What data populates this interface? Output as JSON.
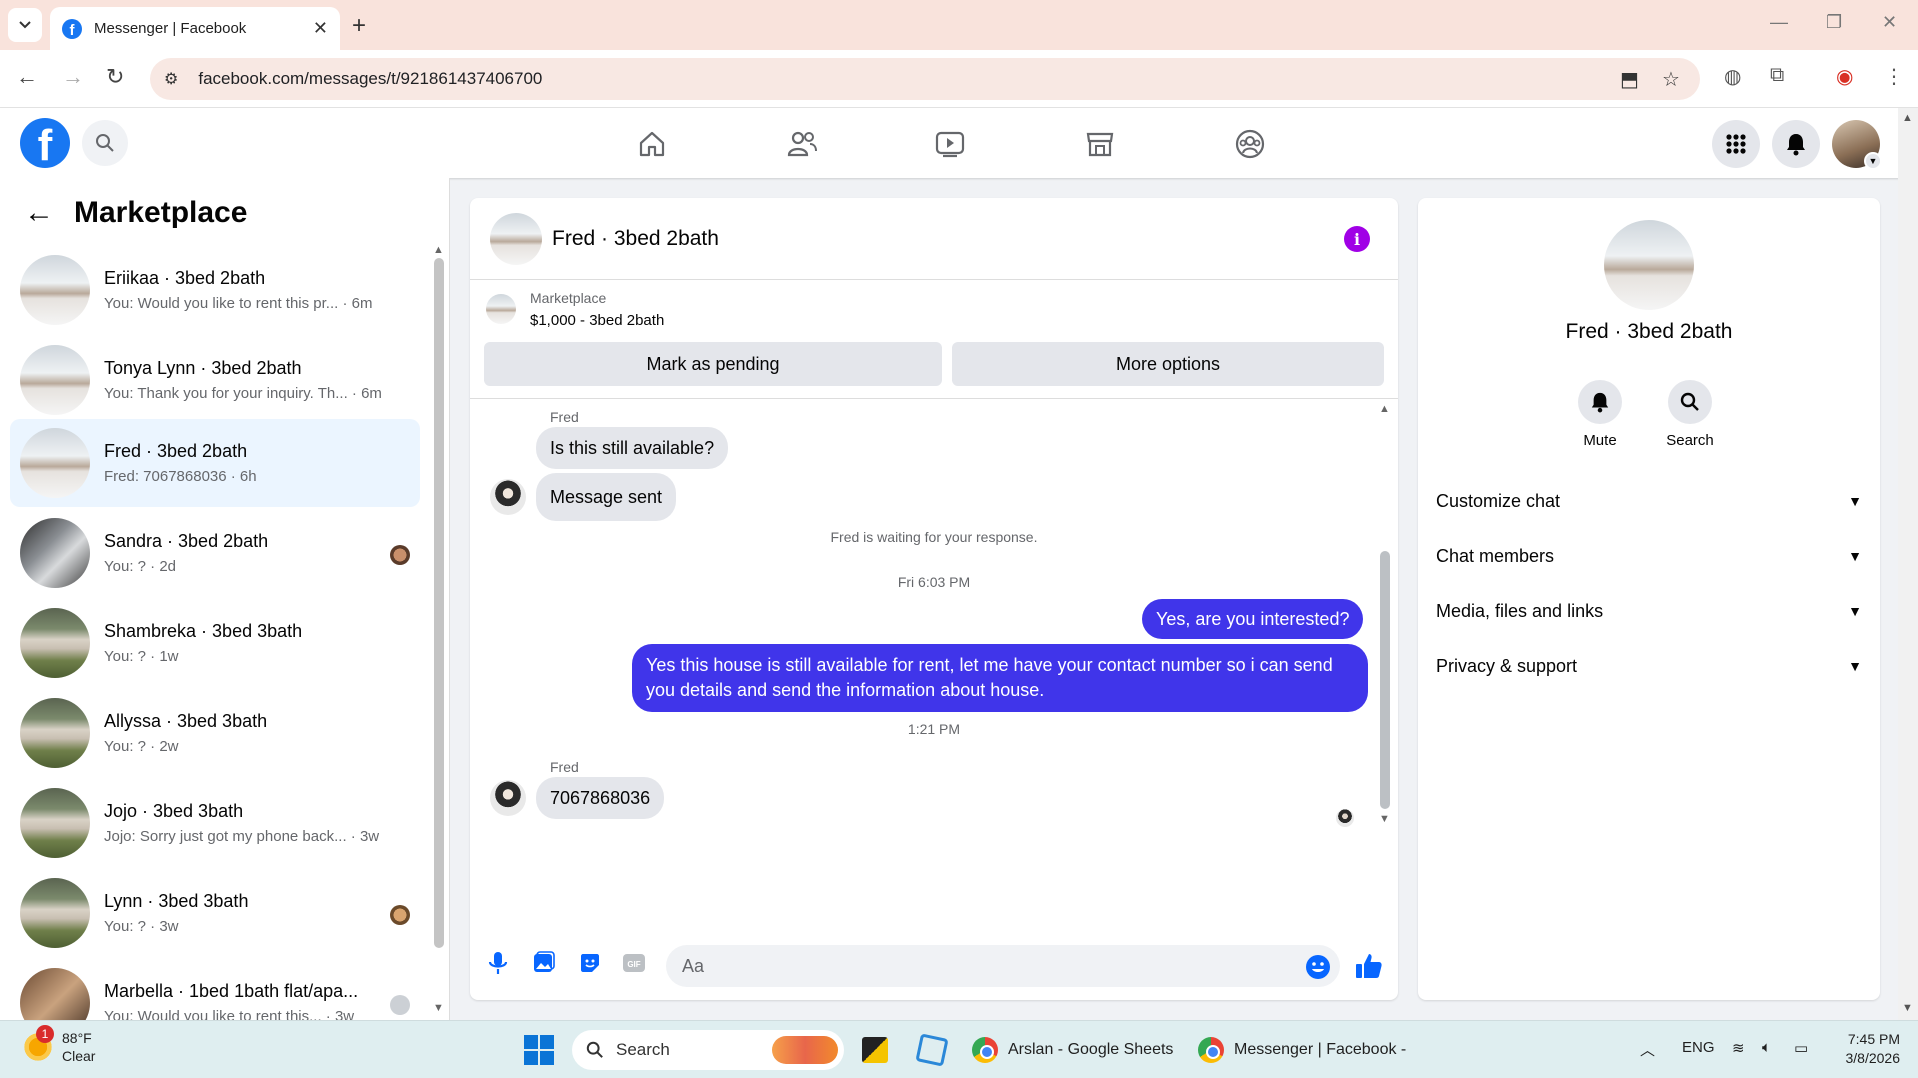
{
  "browser": {
    "tab_title": "Messenger | Facebook",
    "url": "facebook.com/messages/t/921861437406700"
  },
  "sidebar": {
    "title": "Marketplace",
    "conversations": [
      {
        "name": "Eriikaa · 3bed 2bath",
        "preview": "You: Would you like to rent this pr... · 6m",
        "thumb": "snow"
      },
      {
        "name": "Tonya Lynn · 3bed 2bath",
        "preview": "You: Thank you for your inquiry. Th... · 6m",
        "thumb": "snow"
      },
      {
        "name": "Fred · 3bed 2bath",
        "preview": "Fred: 7067868036 · 6h",
        "thumb": "snow",
        "active": true
      },
      {
        "name": "Sandra · 3bed 2bath",
        "preview": "You: ? · 2d",
        "thumb": "kitchen"
      },
      {
        "name": "Shambreka · 3bed 3bath",
        "preview": "You: ? · 1w",
        "thumb": "green"
      },
      {
        "name": "Allyssa · 3bed 3bath",
        "preview": "You: ? · 2w",
        "thumb": "green"
      },
      {
        "name": "Jojo · 3bed 3bath",
        "preview": "Jojo: Sorry just got my phone back... · 3w",
        "thumb": "green"
      },
      {
        "name": "Lynn · 3bed 3bath",
        "preview": "You: ? · 3w",
        "thumb": "green"
      },
      {
        "name": "Marbella · 1bed 1bath flat/apa...",
        "preview": "You: Would you like to rent this... · 3w",
        "thumb": "interior"
      }
    ]
  },
  "chat": {
    "title": "Fred · 3bed 2bath",
    "marketplace_label": "Marketplace",
    "listing": "$1,000 - 3bed 2bath",
    "btn_pending": "Mark as pending",
    "btn_more": "More options",
    "sender_name": "Fred",
    "msg_in_1": "Is this still available?",
    "msg_in_2": "Message sent",
    "waiting_note": "Fred is waiting for your response.",
    "time_1": "Fri 6:03 PM",
    "msg_out_1": "Yes, are you interested?",
    "msg_out_2": "Yes this house is still available for rent, let me have your contact number so i can send you details and send the information about house.",
    "time_2": "1:21 PM",
    "msg_in_3": "7067868036",
    "composer_placeholder": "Aa"
  },
  "info_panel": {
    "name": "Fred · 3bed 2bath",
    "mute_label": "Mute",
    "search_label": "Search",
    "sections": [
      "Customize chat",
      "Chat members",
      "Media, files and links",
      "Privacy & support"
    ]
  },
  "taskbar": {
    "weather_badge": "1",
    "temp": "88°F",
    "condition": "Clear",
    "search_label": "Search",
    "app_sheets": "Arslan - Google Sheets",
    "app_messenger": "Messenger | Facebook -",
    "lang": "ENG",
    "time": "7:45 PM",
    "date": "3/8/2026"
  },
  "colors": {
    "fb_blue": "#1877f2",
    "outgoing_bubble": "#4035ea",
    "active_conv_bg": "#ebf5ff",
    "info_icon": "#a000e6"
  }
}
